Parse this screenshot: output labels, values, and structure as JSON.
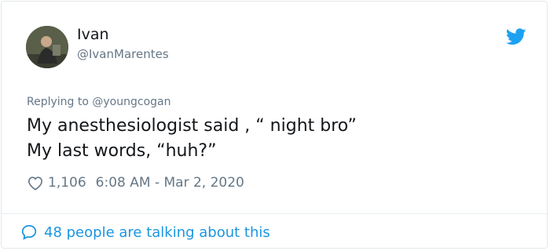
{
  "user": {
    "display_name": "Ivan",
    "handle": "@IvanMarentes"
  },
  "reply": {
    "prefix": "Replying to",
    "mention": "@youngcogan"
  },
  "tweet": {
    "line1": "My anesthesiologist said , “ night bro”",
    "line2": "My last words, “huh?”"
  },
  "meta": {
    "likes": "1,106",
    "timestamp": "6:08 AM - Mar 2, 2020"
  },
  "footer": {
    "talking": "48 people are talking about this"
  },
  "icons": {
    "brand": "twitter-bird-icon",
    "like": "heart-icon",
    "conversation": "speech-bubble-icon"
  },
  "colors": {
    "accent": "#1da1f2",
    "link": "#1b95e0",
    "muted": "#657786",
    "text": "#14171a",
    "border": "#e1e8ed"
  }
}
